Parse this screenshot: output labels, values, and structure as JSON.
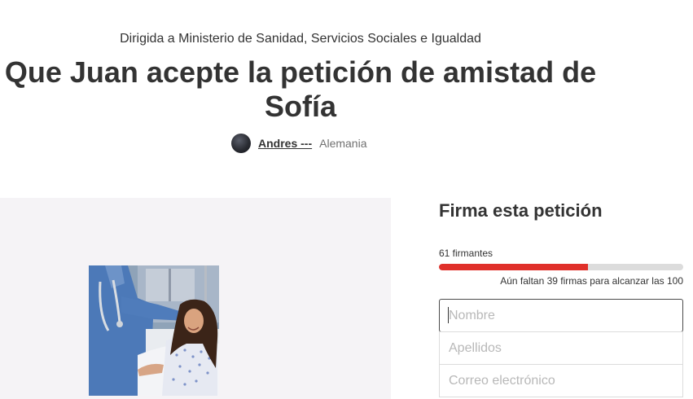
{
  "petition": {
    "addressee": "Dirigida a Ministerio de Sanidad, Servicios Sociales e Igualdad",
    "title_line1": "Que Juan acepte la petición de amistad de",
    "title_line2": "Sofía",
    "author": {
      "name": "Andres ---",
      "location": "Alemania"
    }
  },
  "sign": {
    "heading": "Firma esta petición",
    "signers_text": "61 firmantes",
    "progress": {
      "current": 61,
      "goal": 100,
      "fraction": 0.61,
      "color": "#e0302a"
    },
    "remaining_text": "Aún faltan 39 firmas para alcanzar las 100",
    "fields": {
      "first_name_placeholder": "Nombre",
      "last_name_placeholder": "Apellidos",
      "email_placeholder": "Correo electrónico"
    }
  }
}
